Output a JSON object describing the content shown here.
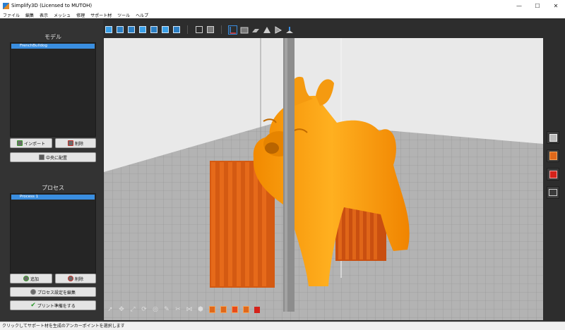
{
  "window": {
    "title": "Simplify3D (Licensed to MUTOH)",
    "minimize_glyph": "—",
    "maximize_glyph": "☐",
    "close_glyph": "✕"
  },
  "menu": [
    "ファイル",
    "編集",
    "表示",
    "メッシュ",
    "修理",
    "サポート材",
    "ツール",
    "ヘルプ"
  ],
  "models_panel": {
    "title": "モデル",
    "items": [
      "FrenchBulldog"
    ],
    "import_label": "インポート",
    "delete_label": "削除",
    "center_label": "中央に配置"
  },
  "process_panel": {
    "title": "プロセス",
    "items": [
      "Process 1"
    ],
    "add_label": "追加",
    "delete_label": "削除",
    "edit_label": "プロセス設定を編集",
    "prepare_label": "プリント準備をする"
  },
  "status_bar": {
    "message": "クリックしてサポート材を生成のアンカーポイントを選択します"
  },
  "colors": {
    "model_orange": "#ffa500",
    "support_orange": "#d45a12",
    "accent_blue": "#3a8ee0"
  }
}
